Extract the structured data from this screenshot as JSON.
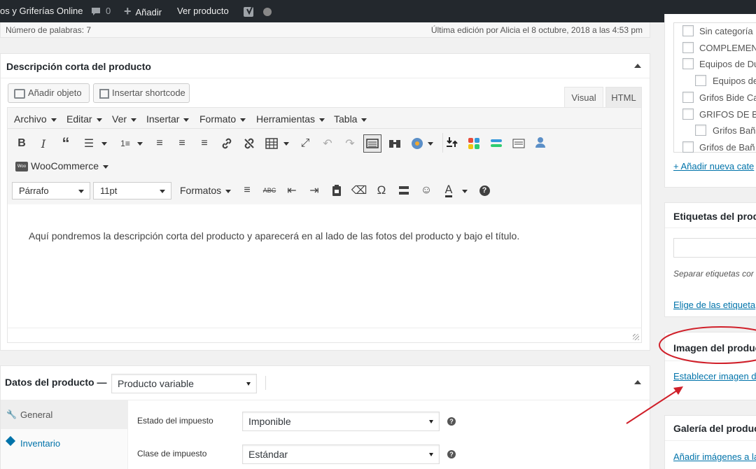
{
  "adminbar": {
    "site_name": "os y Griferías Online",
    "comments_count": "0",
    "new_label": "Añadir",
    "view_label": "Ver producto"
  },
  "status": {
    "word_count": "Número de palabras: 7",
    "last_edit": "Última edición por Alicia el 8 octubre, 2018 a las 4:53 pm"
  },
  "short_desc": {
    "title": "Descripción corta del producto",
    "add_media": "Añadir objeto",
    "insert_shortcode": "Insertar shortcode",
    "tab_visual": "Visual",
    "tab_html": "HTML",
    "menus": [
      "Archivo",
      "Editar",
      "Ver",
      "Insertar",
      "Formato",
      "Herramientas",
      "Tabla"
    ],
    "woocommerce": "WooCommerce",
    "paragraph": "Párrafo",
    "font_size": "11pt",
    "formats": "Formatos",
    "content": "Aquí pondremos la descripción corta del producto y aparecerá en al lado de las fotos del producto y bajo el título."
  },
  "product_data": {
    "title": "Datos del producto —",
    "type_value": "Producto variable",
    "tabs": [
      "General",
      "Inventario"
    ],
    "tax_status_label": "Estado del impuesto",
    "tax_status_value": "Imponible",
    "tax_class_label": "Clase de impuesto",
    "tax_class_value": "Estándar"
  },
  "categories": {
    "items": [
      "Sin categoría",
      "COMPLEMENT",
      "Equipos de Du",
      "Equipos de",
      "Grifos Bide Ca",
      "GRIFOS DE BA",
      "Grifos Bañ",
      "Grifos de Bañ"
    ],
    "add_new": "+ Añadir nueva cate"
  },
  "tags": {
    "title": "Etiquetas del produ",
    "hint": "Separar etiquetas cor",
    "choose": "Elige de las etiqueta"
  },
  "product_image": {
    "title": "Imagen del produc",
    "set_link": "Establecer imagen de"
  },
  "gallery": {
    "title": "Galería del product",
    "add_link": "Añadir imágenes a la"
  },
  "colors": {
    "adminbar_bg": "#23282d",
    "link": "#0073aa",
    "annotation_red": "#d0202a"
  }
}
